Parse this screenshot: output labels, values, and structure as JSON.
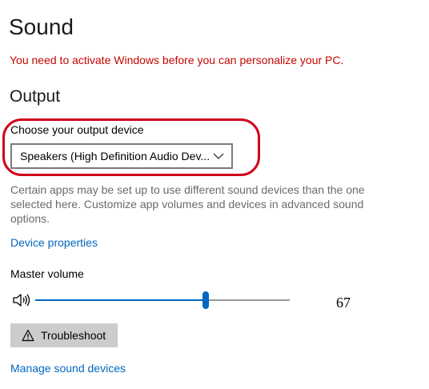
{
  "page": {
    "title": "Sound",
    "activation_warning": "You need to activate Windows before you can personalize your PC."
  },
  "output": {
    "section_title": "Output",
    "device_label": "Choose your output device",
    "device_selected": "Speakers (High Definition Audio Dev...",
    "description": "Certain apps may be set up to use different sound devices than the one selected here. Customize app volumes and devices in advanced sound options.",
    "device_properties_link": "Device properties",
    "master_volume_label": "Master volume",
    "volume_value": "67",
    "volume_level_percent": 67,
    "troubleshoot_label": "Troubleshoot",
    "manage_devices_link": "Manage sound devices"
  },
  "icons": {
    "speaker": "speaker-volume-icon",
    "chevron": "chevron-down-icon",
    "warning": "warning-triangle-icon"
  },
  "colors": {
    "warning_text": "#c50500",
    "link": "#0067c0",
    "accent": "#0067c0",
    "annotation": "#d0021b",
    "button_bg": "#cccccc"
  }
}
